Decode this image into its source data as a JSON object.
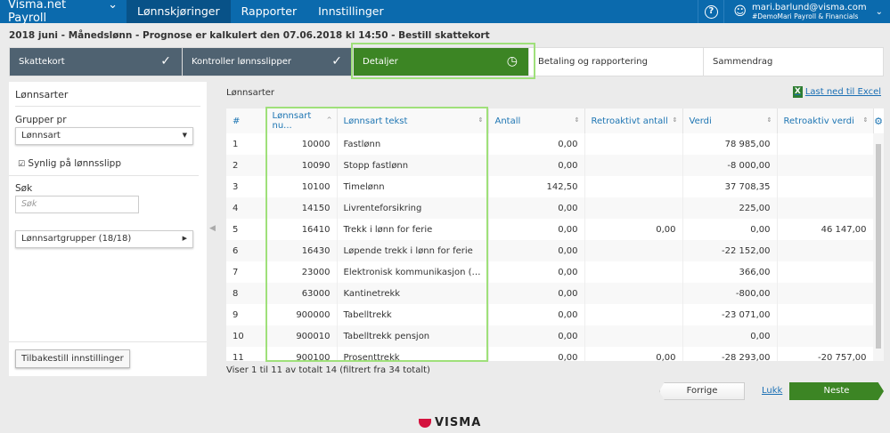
{
  "nav": {
    "brand": "Visma.net Payroll",
    "tabs": [
      "Lønnskjøringer",
      "Rapporter",
      "Innstillinger"
    ],
    "active_tab": 0,
    "user_email": "mari.barlund@visma.com",
    "user_org": "#DemoMari Payroll & Financials"
  },
  "title": "2018 juni - Månedslønn - Prognose er kalkulert den 07.06.2018 kl 14:50 - Bestill skattekort",
  "steps": [
    {
      "label": "Skattekort",
      "status": "done"
    },
    {
      "label": "Kontroller lønnsslipper",
      "status": "done"
    },
    {
      "label": "Detaljer",
      "status": "current"
    },
    {
      "label": "Betaling og rapportering",
      "status": "todo"
    },
    {
      "label": "Sammendrag",
      "status": "todo"
    }
  ],
  "left": {
    "heading": "Lønnsarter",
    "group_label": "Grupper pr",
    "group_value": "Lønnsart",
    "checkbox_label": "Synlig på lønnsslipp",
    "checkbox_checked": true,
    "search_label": "Søk",
    "search_placeholder": "Søk",
    "groups_label": "Lønnsartgrupper (18/18)",
    "reset_label": "Tilbakestill innstillinger"
  },
  "main": {
    "section": "Lønnsarter",
    "excel_link": "Last ned til Excel",
    "columns": [
      "#",
      "Lønnsart nu...",
      "Lønnsart tekst",
      "Antall",
      "Retroaktivt antall",
      "Verdi",
      "Retroaktiv verdi"
    ],
    "rows": [
      [
        "1",
        "10000",
        "Fastlønn",
        "0,00",
        "",
        "78 985,00",
        ""
      ],
      [
        "2",
        "10090",
        "Stopp fastlønn",
        "0,00",
        "",
        "-8 000,00",
        ""
      ],
      [
        "3",
        "10100",
        "Timelønn",
        "142,50",
        "",
        "37 708,35",
        ""
      ],
      [
        "4",
        "14150",
        "Livrenteforsikring",
        "0,00",
        "",
        "225,00",
        ""
      ],
      [
        "5",
        "16410",
        "Trekk i lønn for ferie",
        "0,00",
        "0,00",
        "0,00",
        "46 147,00"
      ],
      [
        "6",
        "16430",
        "Løpende trekk i lønn for ferie",
        "0,00",
        "",
        "-22 152,00",
        ""
      ],
      [
        "7",
        "23000",
        "Elektronisk kommunikasjon (natur...",
        "0,00",
        "",
        "366,00",
        ""
      ],
      [
        "8",
        "63000",
        "Kantinetrekk",
        "0,00",
        "",
        "-800,00",
        ""
      ],
      [
        "9",
        "900000",
        "Tabelltrekk",
        "0,00",
        "",
        "-23 071,00",
        ""
      ],
      [
        "10",
        "900010",
        "Tabelltrekk pensjon",
        "0,00",
        "",
        "0,00",
        ""
      ],
      [
        "11",
        "900100",
        "Prosenttrekk",
        "0,00",
        "0,00",
        "-28 293,00",
        "-20 757,00"
      ]
    ],
    "footer": "Viser 1 til 11 av totalt 14 (filtrert fra 34 totalt)"
  },
  "actions": {
    "prev": "Forrige",
    "close": "Lukk",
    "next": "Neste"
  },
  "logo": "VISMA",
  "colors": {
    "nav": "#0b6aad",
    "step_done": "#4f6271",
    "step_current": "#3c8524",
    "highlight": "#9fe07a"
  }
}
